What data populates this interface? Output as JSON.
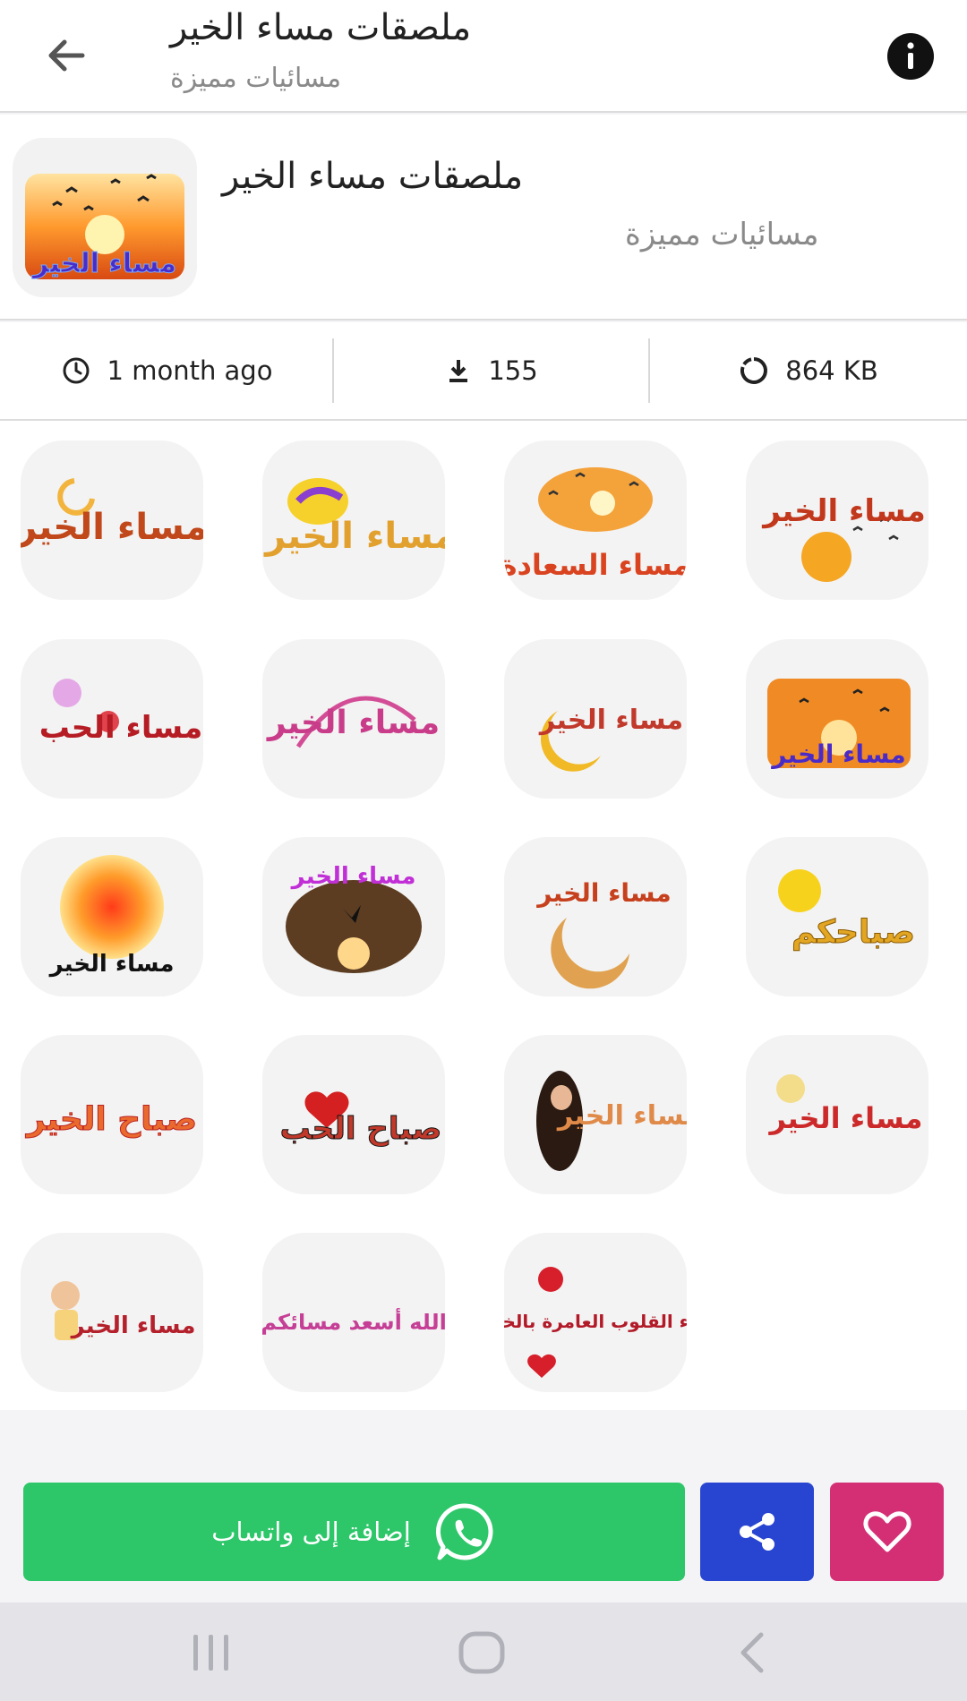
{
  "appbar": {
    "title": "ملصقات مساء الخير",
    "subtitle": "مسائيات مميزة"
  },
  "pack": {
    "name": "ملصقات مساء الخير",
    "author": "مسائيات مميزة",
    "thumbnail_text": "مساء الخير"
  },
  "stats": {
    "updated": "1 month ago",
    "downloads": "155",
    "size": "864 KB"
  },
  "stickers": [
    {
      "text": "مساء الخير"
    },
    {
      "text": "مساء الخير"
    },
    {
      "text": "مساء السعادة"
    },
    {
      "text": "مساء الخير"
    },
    {
      "text": "مساء الحب"
    },
    {
      "text": "مساء الخير"
    },
    {
      "text": "مساء الخير"
    },
    {
      "text": "مساء الخير"
    },
    {
      "text": "مساء الخير"
    },
    {
      "text": "مساء الخير"
    },
    {
      "text": "مساء الخير"
    },
    {
      "text": "صباحكم"
    },
    {
      "text": "صباح الخير"
    },
    {
      "text": "صباح الحب"
    },
    {
      "text": "مساء الخير"
    },
    {
      "text": "مساء الخير"
    },
    {
      "text": "مساء الخير"
    },
    {
      "text": "الله أسعد مسائكم"
    },
    {
      "text": "مساء القلوب العامرة بالخير"
    }
  ],
  "actions": {
    "add_to_whatsapp": "إضافة إلى واتساب"
  },
  "colors": {
    "whatsapp_green": "#2dc76a",
    "share_blue": "#2845d1",
    "favorite_pink": "#d42f75"
  }
}
